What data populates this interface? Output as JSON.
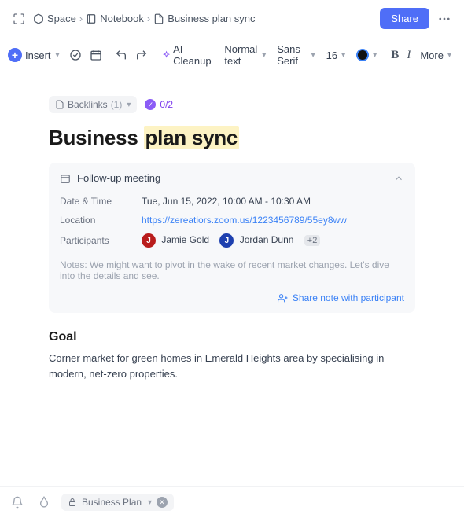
{
  "breadcrumb": {
    "space": "Space",
    "notebook": "Notebook",
    "page": "Business plan sync"
  },
  "header": {
    "share": "Share"
  },
  "toolbar": {
    "insert": "Insert",
    "ai_cleanup": "AI Cleanup",
    "para_style": "Normal text",
    "font_family": "Sans Serif",
    "font_size": "16",
    "more": "More"
  },
  "chips": {
    "backlinks_label": "Backlinks",
    "backlinks_count": "(1)",
    "tasks": "0/2"
  },
  "title": {
    "plain": "Business ",
    "highlighted": "plan sync"
  },
  "meeting": {
    "title": "Follow-up meeting",
    "rows": {
      "datetime_label": "Date & Time",
      "datetime_value": "Tue, Jun 15, 2022, 10:00 AM - 10:30 AM",
      "location_label": "Location",
      "location_value": "https://zereatiors.zoom.us/1223456789/55ey8ww",
      "participants_label": "Participants"
    },
    "participants": [
      {
        "initial": "J",
        "name": "Jamie Gold"
      },
      {
        "initial": "J",
        "name": "Jordan Dunn"
      }
    ],
    "more_participants": "+2",
    "notes": "Notes: We might want to pivot in the wake of recent market changes. Let's dive into the details and see.",
    "share_note": "Share note with participant"
  },
  "goal": {
    "heading": "Goal",
    "body": "Corner market for green homes in Emerald Heights area by specialising in modern, net-zero properties."
  },
  "footer": {
    "tag": "Business Plan"
  }
}
